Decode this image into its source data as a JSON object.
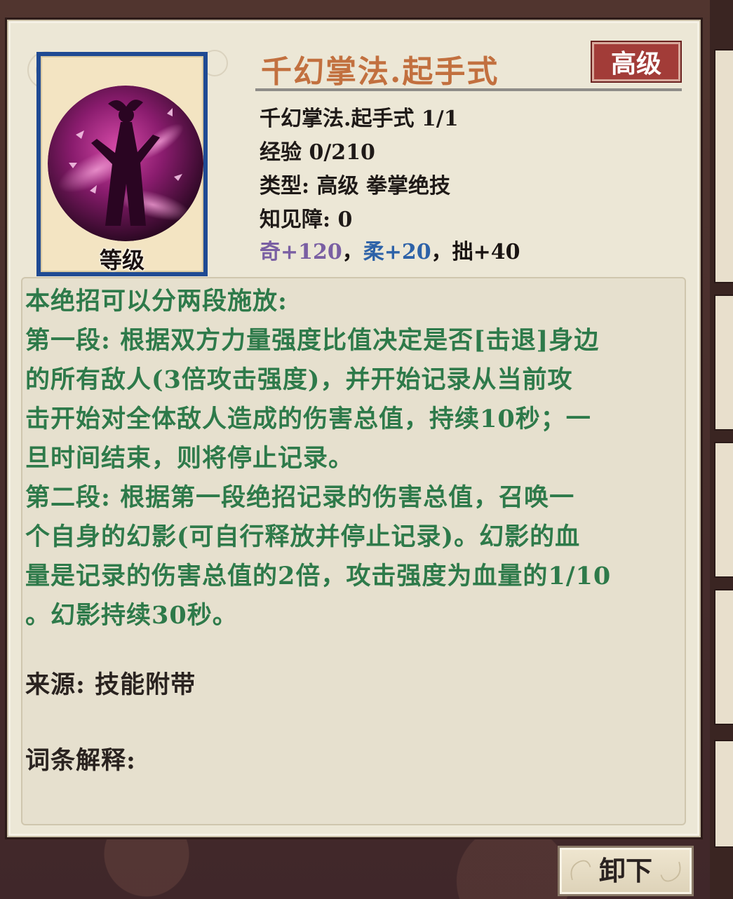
{
  "skill": {
    "title": "千幻掌法.起手式",
    "rank_badge": "高级",
    "icon_label": "等级",
    "name_line": "千幻掌法.起手式 1/1",
    "exp_line": "经验 0/210",
    "type_line": "类型: 高级 拳掌绝技",
    "obstacle_line": "知见障: 0",
    "stats": {
      "qi": "奇+120",
      "rou": "柔+20",
      "zhuo": "拙+40",
      "separator": "，"
    }
  },
  "description": {
    "text": "本绝招可以分两段施放:\n第一段: 根据双方力量强度比值决定是否[击退]身边\n的所有敌人(3倍攻击强度)，并开始记录从当前攻\n击开始对全体敌人造成的伤害总值，持续10秒；一\n旦时间结束，则将停止记录。\n第二段: 根据第一段绝招记录的伤害总值，召唤一\n个自身的幻影(可自行释放并停止记录)。幻影的血\n量是记录的伤害总值的2倍，攻击强度为血量的1/10\n。幻影持续30秒。",
    "source": "来源: 技能附带",
    "glossary": "词条解释:"
  },
  "actions": {
    "unequip_label": "卸下"
  },
  "colors": {
    "title": "#c2703f",
    "description": "#2e7a4a",
    "badge": "#a23c38",
    "stat_qi": "#7a5fa3",
    "stat_rou": "#2d62a8"
  },
  "icons": {
    "skill": "dancer-silhouette-petals-icon"
  }
}
